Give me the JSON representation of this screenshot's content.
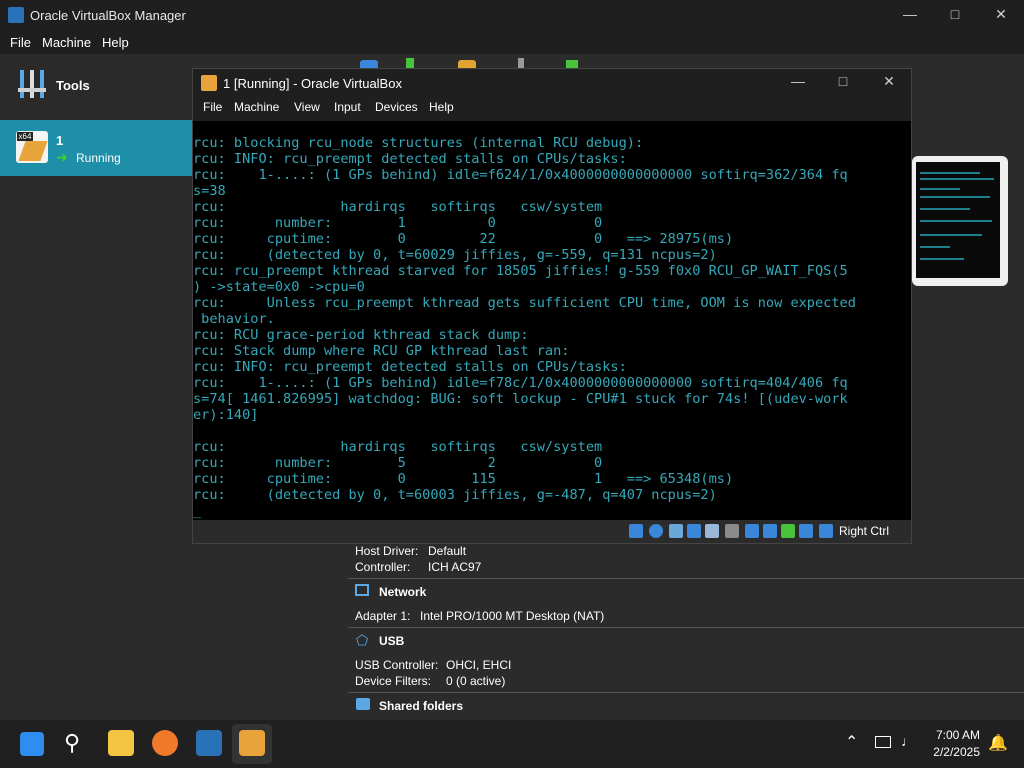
{
  "manager": {
    "title": "Oracle VirtualBox Manager",
    "menu": [
      "File",
      "Machine",
      "Help"
    ],
    "tools_label": "Tools",
    "vm_item": {
      "name": "1",
      "state": "Running"
    },
    "details": {
      "audio_host_driver_label": "Host Driver:",
      "audio_host_driver_value": "Default",
      "audio_controller_label": "Controller:",
      "audio_controller_value": "ICH AC97",
      "network_heading": "Network",
      "adapter_label": "Adapter 1:",
      "adapter_value": "Intel PRO/1000 MT Desktop (NAT)",
      "usb_heading": "USB",
      "usb_controller_label": "USB Controller:",
      "usb_controller_value": "OHCI, EHCI",
      "device_filters_label": "Device Filters:",
      "device_filters_value": "0 (0 active)",
      "shared_folders_heading": "Shared folders"
    }
  },
  "vm_window": {
    "title": "1 [Running] - Oracle VirtualBox",
    "menu": [
      "File",
      "Machine",
      "View",
      "Input",
      "Devices",
      "Help"
    ],
    "host_key": "Right Ctrl",
    "console_lines": [
      "rcu: blocking rcu_node structures (internal RCU debug):",
      "rcu: INFO: rcu_preempt detected stalls on CPUs/tasks:",
      "rcu:    1-....: (1 GPs behind) idle=f624/1/0x4000000000000000 softirq=362/364 fq",
      "s=38",
      "rcu:              hardirqs   softirqs   csw/system",
      "rcu:      number:        1          0            0",
      "rcu:     cputime:        0         22            0   ==> 28975(ms)",
      "rcu:     (detected by 0, t=60029 jiffies, g=-559, q=131 ncpus=2)",
      "rcu: rcu_preempt kthread starved for 18505 jiffies! g-559 f0x0 RCU_GP_WAIT_FQS(5",
      ") ->state=0x0 ->cpu=0",
      "rcu:     Unless rcu_preempt kthread gets sufficient CPU time, OOM is now expected",
      " behavior.",
      "rcu: RCU grace-period kthread stack dump:",
      "rcu: Stack dump where RCU GP kthread last ran:",
      "rcu: INFO: rcu_preempt detected stalls on CPUs/tasks:",
      "rcu:    1-....: (1 GPs behind) idle=f78c/1/0x4000000000000000 softirq=404/406 fq",
      "s=74[ 1461.826995] watchdog: BUG: soft lockup - CPU#1 stuck for 74s! [(udev-work",
      "er):140]",
      "",
      "rcu:              hardirqs   softirqs   csw/system",
      "rcu:      number:        5          2            0",
      "rcu:     cputime:        0        115            1   ==> 65348(ms)",
      "rcu:     (detected by 0, t=60003 jiffies, g=-487, q=407 ncpus=2)",
      "_"
    ]
  },
  "taskbar": {
    "time": "7:00 AM",
    "date": "2/2/2025"
  },
  "colors": {
    "console_text": "#35a8b9",
    "selection": "#1e8fa8"
  }
}
